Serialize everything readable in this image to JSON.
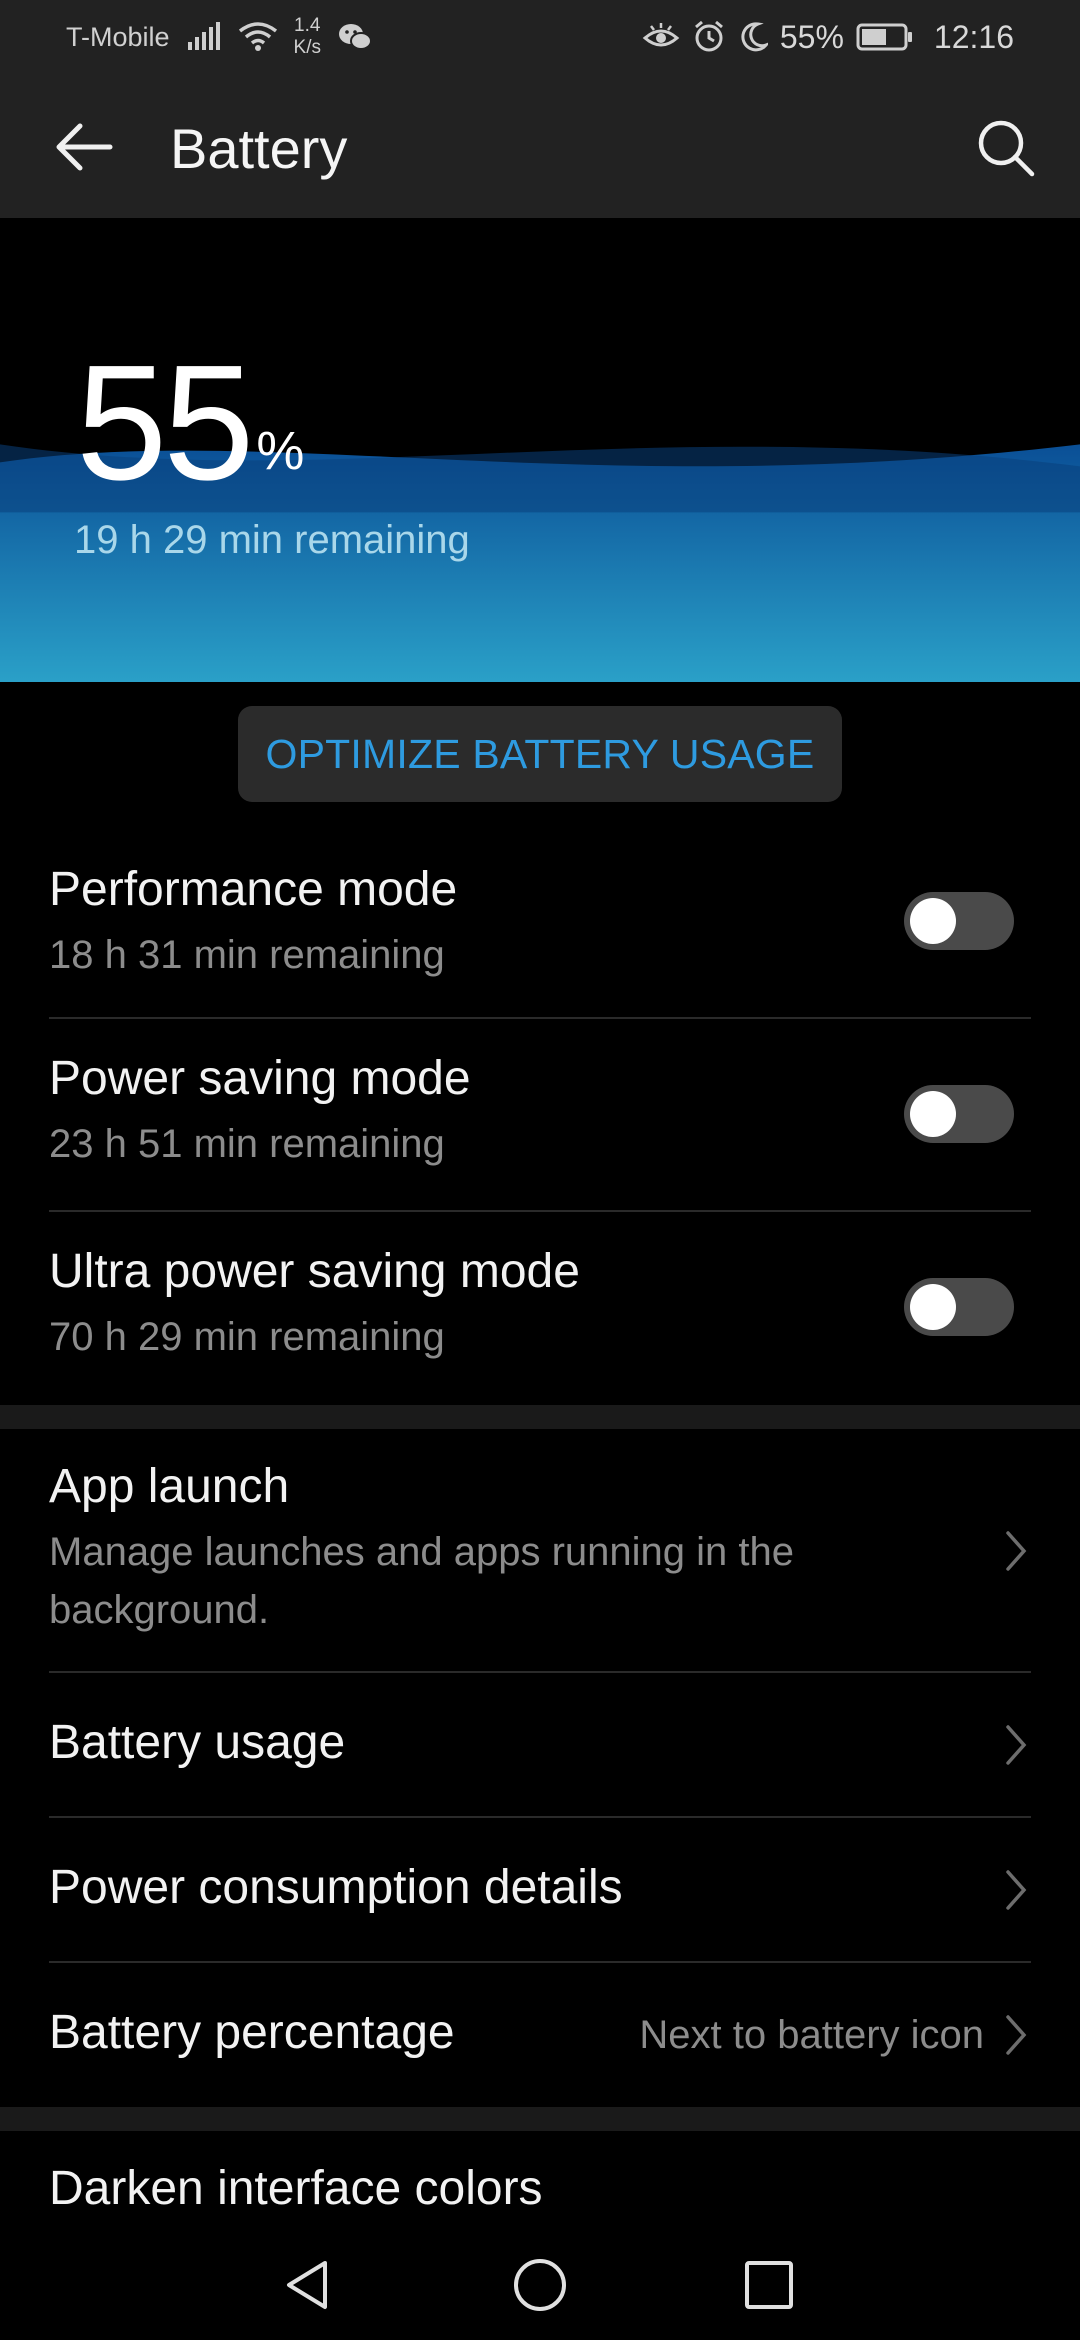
{
  "status_bar": {
    "carrier": "T-Mobile",
    "speed_value": "1.4",
    "speed_unit": "K/s",
    "battery_percent": "55%",
    "time": "12:16",
    "icons": [
      "signal-icon",
      "wifi-icon",
      "wechat-icon",
      "eye-comfort-icon",
      "alarm-icon",
      "moon-icon",
      "battery-icon"
    ]
  },
  "app_bar": {
    "title": "Battery",
    "back_icon": "arrow-left-icon",
    "search_icon": "search-icon"
  },
  "hero": {
    "level": "55",
    "percent_sign": "%",
    "remaining": "19 h 29 min remaining",
    "level_fraction": 0.55,
    "colors": {
      "wave_top": "#0a4f96",
      "wave_bottom": "#2aa0c8"
    }
  },
  "optimize": {
    "label": "OPTIMIZE BATTERY USAGE",
    "color": "#2e9be0"
  },
  "modes": [
    {
      "title": "Performance mode",
      "subtitle": "18 h 31 min remaining",
      "enabled": false
    },
    {
      "title": "Power saving mode",
      "subtitle": "23 h 51 min remaining",
      "enabled": false
    },
    {
      "title": "Ultra power saving mode",
      "subtitle": "70 h 29 min remaining",
      "enabled": false
    }
  ],
  "settings": {
    "app_launch": {
      "title": "App launch",
      "subtitle_line1": "Manage launches and apps running in the",
      "subtitle_line2": "background."
    },
    "battery_usage": {
      "title": "Battery usage"
    },
    "power_consumption": {
      "title": "Power consumption details"
    },
    "battery_percentage": {
      "title": "Battery percentage",
      "value": "Next to battery icon"
    },
    "darken_colors": {
      "title": "Darken interface colors"
    }
  },
  "nav_bar": {
    "icons": [
      "nav-back-icon",
      "nav-home-icon",
      "nav-recents-icon"
    ]
  }
}
